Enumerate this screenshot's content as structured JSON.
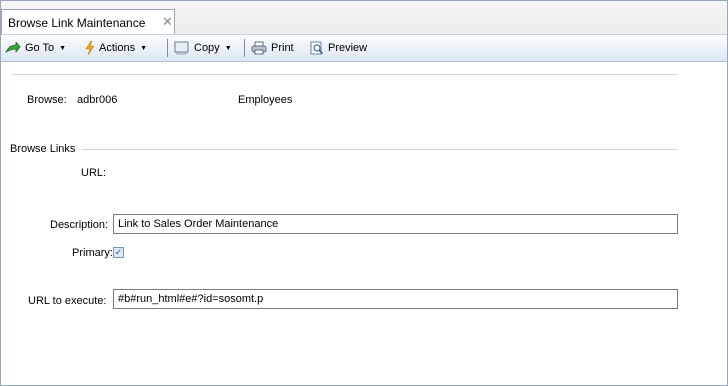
{
  "tab": {
    "title": "Browse Link Maintenance",
    "close_glyph": "✕"
  },
  "toolbar": {
    "goto_label": "Go To",
    "actions_label": "Actions",
    "copy_label": "Copy",
    "print_label": "Print",
    "preview_label": "Preview",
    "caret_glyph": "▼"
  },
  "form": {
    "browse_label": "Browse:",
    "browse_value": "adbr006",
    "browse_desc": "Employees",
    "section_title": "Browse Links",
    "url_label": "URL:",
    "description_label": "Description:",
    "description_value": "Link to Sales Order Maintenance",
    "primary_label": "Primary:",
    "primary_checked": true,
    "url_execute_label": "URL to execute:",
    "url_execute_value": "#b#run_html#e#?id=sosomt.p"
  },
  "colors": {
    "border": "#9aa7b8",
    "toolbar_bottom": "#dde6f1",
    "check_mark": "#2a4f86"
  }
}
